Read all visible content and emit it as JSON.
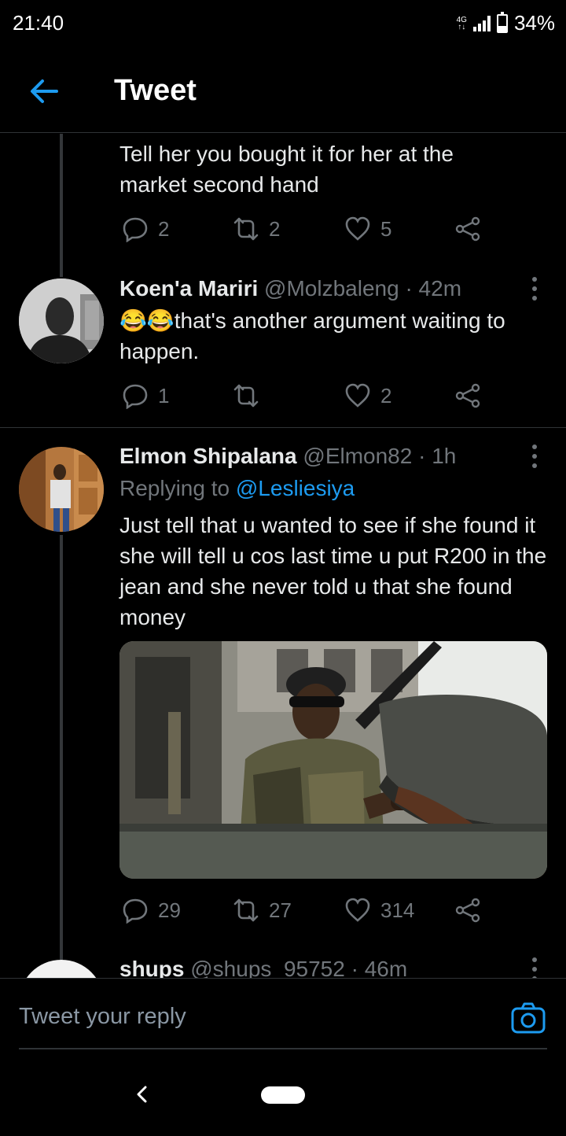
{
  "status_bar": {
    "time": "21:40",
    "network": "4G",
    "battery": "34%"
  },
  "header": {
    "title": "Tweet"
  },
  "tweets": [
    {
      "text": "Tell her you bought it for her at the market second hand",
      "replies": "2",
      "retweets": "2",
      "likes": "5"
    },
    {
      "name": "Koen'a Mariri",
      "handle": "@Molzbaleng",
      "time": "· 42m",
      "emoji": "😂😂",
      "text": "that's another argument waiting to happen.",
      "replies": "1",
      "retweets": "",
      "likes": "2"
    },
    {
      "name": "Elmon Shipalana",
      "handle": "@Elmon82",
      "time": "· 1h",
      "replying_label": "Replying to",
      "replying_to": "@Lesliesiya",
      "text": "Just tell that u wanted to see if she found it she will tell u cos last time u put R200 in the jean  and she never told u that she found money",
      "replies": "29",
      "retweets": "27",
      "likes": "314"
    },
    {
      "name": "shups",
      "handle": "@shups_95752",
      "time": "· 46m"
    }
  ],
  "reply_box": {
    "placeholder": "Tweet your reply"
  },
  "colors": {
    "accent": "#1d9bf0",
    "muted": "#71767b",
    "background": "#000000"
  }
}
